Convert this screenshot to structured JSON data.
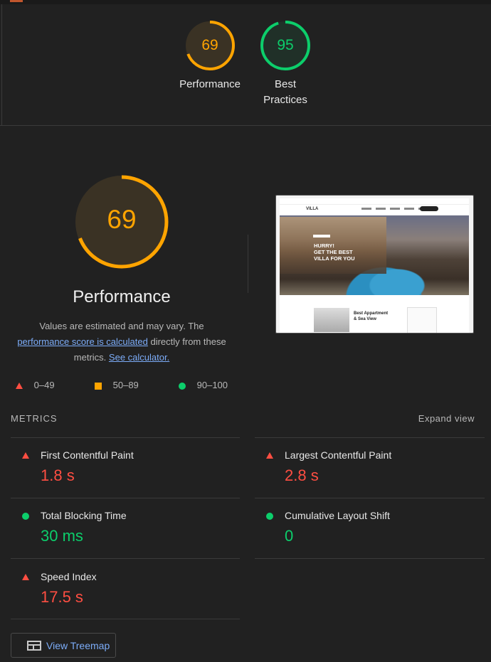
{
  "header": {
    "gauges": [
      {
        "score": "69",
        "label_lines": [
          "Performance"
        ],
        "color": "#ffa400",
        "fraction": 0.69
      },
      {
        "score": "95",
        "label_lines": [
          "Best",
          "Practices"
        ],
        "color": "#0cce6b",
        "fraction": 0.95
      }
    ]
  },
  "performance": {
    "score": "69",
    "fraction": 0.69,
    "title": "Performance",
    "desc_part1": "Values are estimated and may vary. The",
    "link_calculated": "performance score is calculated",
    "desc_part2": "directly from these metrics.",
    "link_calculator": "See calculator.",
    "legend": [
      {
        "range": "0–49",
        "shape": "triangle",
        "color": "#ff4e42"
      },
      {
        "range": "50–89",
        "shape": "square",
        "color": "#ffa400"
      },
      {
        "range": "90–100",
        "shape": "circle",
        "color": "#0cce6b"
      }
    ]
  },
  "screenshot": {
    "logo": "VILLA",
    "hero_text": [
      "HURRY!",
      "GET THE BEST",
      "VILLA FOR YOU"
    ],
    "card_title": [
      "Best Appartment",
      "& Sea View"
    ]
  },
  "metrics": {
    "heading": "METRICS",
    "expand_label": "Expand view",
    "items": [
      {
        "title": "First Contentful Paint",
        "value": "1.8 s",
        "status": "fail"
      },
      {
        "title": "Largest Contentful Paint",
        "value": "2.8 s",
        "status": "fail"
      },
      {
        "title": "Total Blocking Time",
        "value": "30 ms",
        "status": "pass"
      },
      {
        "title": "Cumulative Layout Shift",
        "value": "0",
        "status": "pass"
      },
      {
        "title": "Speed Index",
        "value": "17.5 s",
        "status": "fail"
      }
    ]
  },
  "treemap": {
    "label": "View Treemap"
  }
}
